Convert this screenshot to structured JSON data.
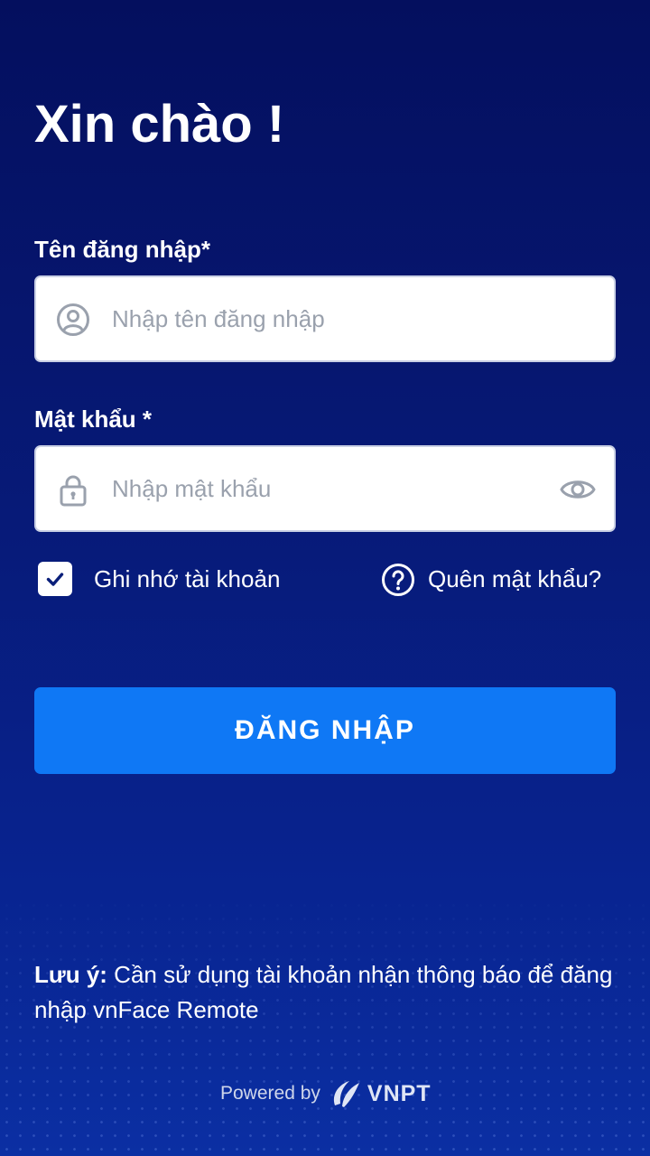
{
  "greeting": "Xin chào !",
  "username": {
    "label": "Tên đăng nhập*",
    "placeholder": "Nhập tên đăng nhập",
    "icon": "user-circle-icon"
  },
  "password": {
    "label": "Mật khẩu *",
    "placeholder": "Nhập mật khẩu",
    "icon": "lock-icon",
    "toggle_icon": "eye-icon"
  },
  "remember": {
    "label": "Ghi nhớ tài khoản",
    "checked": true
  },
  "forgot": {
    "label": "Quên mật khẩu?",
    "icon": "question-circle-icon"
  },
  "login_button": "ĐĂNG NHẬP",
  "note": {
    "prefix": "Lưu ý:",
    "text": " Cần sử dụng tài khoản nhận thông báo để đăng nhập vnFace Remote"
  },
  "footer": {
    "powered_by": "Powered by",
    "brand": "VNPT"
  },
  "colors": {
    "background": "#071a78",
    "primary_button": "#0f78f5",
    "input_background": "#ffffff",
    "placeholder": "#9aa1ad"
  }
}
